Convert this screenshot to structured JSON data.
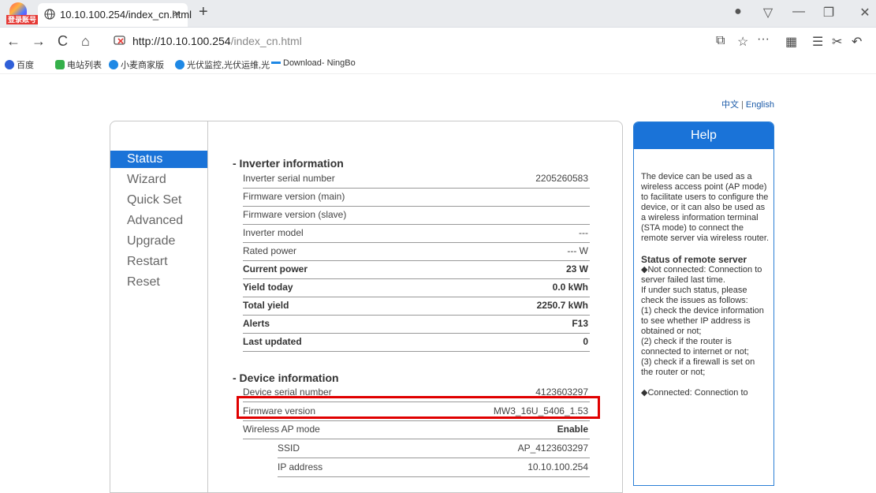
{
  "browser": {
    "login_badge": "登录账号",
    "tab_title": "10.10.100.254/index_cn.html",
    "tab_close": "×",
    "new_tab": "+",
    "url_host": "http://10.10.100.254",
    "url_path": "/index_cn.html",
    "bookmarks": [
      {
        "label": "百度",
        "color": "#2f5fd8"
      },
      {
        "label": "电站列表",
        "color": "#35b04a"
      },
      {
        "label": "小麦商家版",
        "color": "#1e88e5"
      },
      {
        "label": "光伏监控,光伏运维,光",
        "color": "#1e88e5"
      },
      {
        "label": "Download- NingBo",
        "color": "#1e88e5"
      }
    ],
    "toolbar_more": "···"
  },
  "lang": {
    "chinese": "中文",
    "separator": "|",
    "english": "English"
  },
  "menu": [
    {
      "label": "Status",
      "active": true
    },
    {
      "label": "Wizard",
      "active": false
    },
    {
      "label": "Quick Set",
      "active": false
    },
    {
      "label": "Advanced",
      "active": false
    },
    {
      "label": "Upgrade",
      "active": false
    },
    {
      "label": "Restart",
      "active": false
    },
    {
      "label": "Reset",
      "active": false
    }
  ],
  "inverter": {
    "title": "-  Inverter information",
    "rows": [
      {
        "label": "Inverter serial number",
        "value": "2205260583",
        "bold": false
      },
      {
        "label": "Firmware version (main)",
        "value": "",
        "bold": false
      },
      {
        "label": "Firmware version (slave)",
        "value": "",
        "bold": false
      },
      {
        "label": "Inverter model",
        "value": "---",
        "bold": false
      },
      {
        "label": "Rated power",
        "value": "--- W",
        "bold": false
      },
      {
        "label": "Current power",
        "value": "23 W",
        "bold": true
      },
      {
        "label": "Yield today",
        "value": "0.0 kWh",
        "bold": true
      },
      {
        "label": "Total yield",
        "value": "2250.7 kWh",
        "bold": true
      },
      {
        "label": "Alerts",
        "value": "F13",
        "bold": true
      },
      {
        "label": "Last updated",
        "value": "0",
        "bold": true
      }
    ]
  },
  "device": {
    "title": "-  Device information",
    "rows": [
      {
        "label": "Device serial number",
        "value": "4123603297"
      },
      {
        "label": "Firmware version",
        "value": "MW3_16U_5406_1.53"
      },
      {
        "label": "Wireless AP mode",
        "value": "Enable"
      },
      {
        "label": "SSID",
        "value": "AP_4123603297"
      },
      {
        "label": "IP address",
        "value": "10.10.100.254"
      }
    ]
  },
  "help": {
    "title": "Help",
    "intro": "The device can be used as a wireless access point (AP mode) to facilitate users to configure the device, or it can also be used as a wireless information terminal (STA mode) to connect the remote server via wireless router.",
    "remote_heading": "Status of remote server",
    "not_connected": "◆Not connected: Connection to server failed last time.",
    "checks_intro": "If under such status, please check the issues as follows:",
    "check1": "(1) check the device information to see whether IP address is obtained or not;",
    "check2": "(2) check if the router is connected to internet or not;",
    "check3": "(3) check if a firewall is set on the router or not;",
    "connected": "◆Connected: Connection to"
  },
  "colors": {
    "accent": "#1a73d8",
    "highlight": "#e00000",
    "link": "#1a5aa8"
  }
}
